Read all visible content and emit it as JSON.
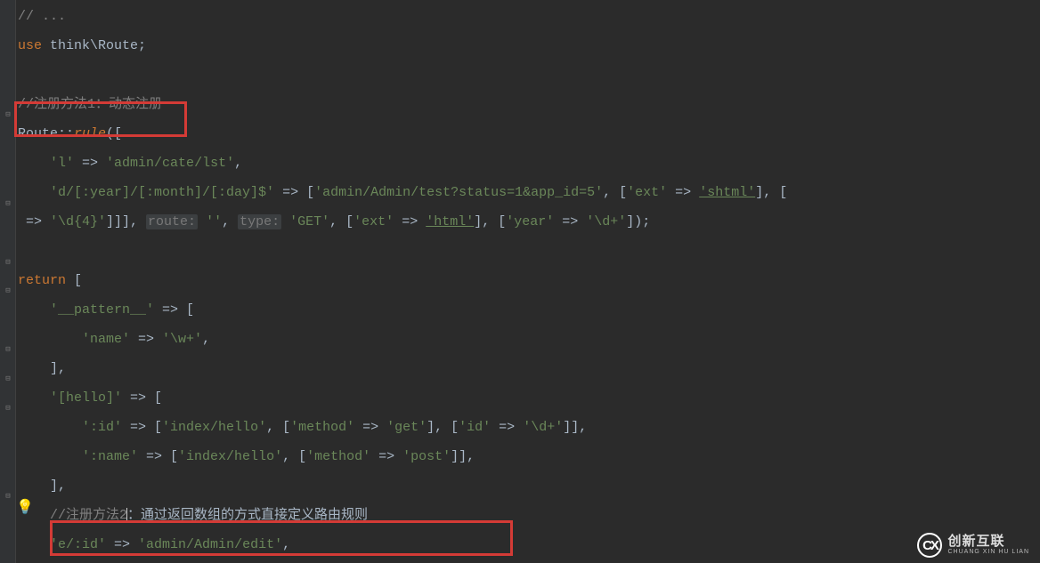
{
  "code": {
    "l0": "// ...",
    "l1_kw": "use ",
    "l1_ns": "think\\Route",
    "l1_end": ";",
    "l3_cmt": "//注册方法1：动态注册",
    "l4_a": "Route::",
    "l4_fn": "rule",
    "l4_b": "([",
    "l5_a": "    ",
    "l5_s1": "'l'",
    "l5_b": " => ",
    "l5_s2": "'admin/cate/lst'",
    "l5_c": ",",
    "l6_a": "    ",
    "l6_s1": "'d/[:year]/[:month]/[:day]$'",
    "l6_b": " => [",
    "l6_s2": "'admin/Admin/test?status=1&app_id=5'",
    "l6_c": ", [",
    "l6_s3": "'ext'",
    "l6_d": " => ",
    "l6_s4": "'shtml'",
    "l6_e": "], [",
    "l7_a": " => ",
    "l7_s1": "'\\d{4}'",
    "l7_b": "]]], ",
    "l7_ph1": "route:",
    "l7_c": " ",
    "l7_s2": "''",
    "l7_d": ", ",
    "l7_ph2": "type:",
    "l7_e": " ",
    "l7_s3": "'GET'",
    "l7_f": ", [",
    "l7_s4": "'ext'",
    "l7_g": " => ",
    "l7_s5": "'html'",
    "l7_h": "], [",
    "l7_s6": "'year'",
    "l7_i": " => ",
    "l7_s7": "'\\d+'",
    "l7_j": "]);",
    "l9_kw": "return ",
    "l9_b": "[",
    "l10_a": "    ",
    "l10_s1": "'__pattern__'",
    "l10_b": " => [",
    "l11_a": "        ",
    "l11_s1": "'name'",
    "l11_b": " => ",
    "l11_s2": "'\\w+'",
    "l11_c": ",",
    "l12_a": "    ],",
    "l13_a": "    ",
    "l13_s1": "'[hello]'",
    "l13_b": " => [",
    "l14_a": "        ",
    "l14_s1": "':id'",
    "l14_b": " => [",
    "l14_s2": "'index/hello'",
    "l14_c": ", [",
    "l14_s3": "'method'",
    "l14_d": " => ",
    "l14_s4": "'get'",
    "l14_e": "], [",
    "l14_s5": "'id'",
    "l14_f": " => ",
    "l14_s6": "'\\d+'",
    "l14_g": "]],",
    "l15_a": "        ",
    "l15_s1": "':name'",
    "l15_b": " => [",
    "l15_s2": "'index/hello'",
    "l15_c": ", [",
    "l15_s3": "'method'",
    "l15_d": " => ",
    "l15_s4": "'post'",
    "l15_e": "]],",
    "l16_a": "    ],",
    "l17_cmt1": "    //注册方法2",
    "l17_cmt2": "：通过返回数组的方式直接定义路由规则",
    "l18_a": "    ",
    "l18_s1": "'e/:id'",
    "l18_b": " => ",
    "l18_s2": "'admin/Admin/edit'",
    "l18_c": ","
  },
  "logo": {
    "mark": "CX",
    "cn": "创新互联",
    "en": "CHUANG XIN HU LIAN"
  }
}
